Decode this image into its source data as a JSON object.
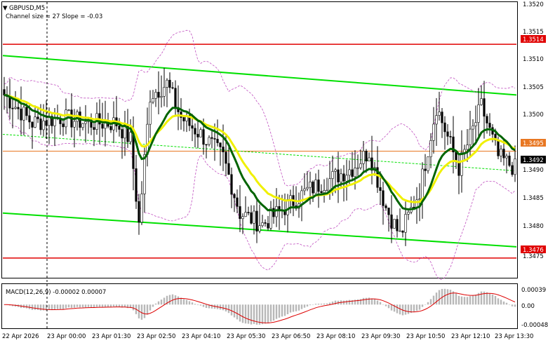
{
  "window": {
    "symbol_title": "GBPUSD,M5",
    "indicator_line": "Channel size = 27 Slope = -0.03",
    "menu_icon": "triangle-down-icon"
  },
  "price_axis": {
    "ticks": [
      "1.3520",
      "1.3515",
      "1.3510",
      "1.3505",
      "1.3500",
      "1.3490",
      "1.3485",
      "1.3480",
      "1.3475"
    ],
    "badges": [
      {
        "label": "1.3514",
        "color": "#e00000",
        "text_color": "#ffffff"
      },
      {
        "label": "1.3495",
        "color": "#e87722",
        "text_color": "#ffffff"
      },
      {
        "label": "1.3492",
        "color": "#000000",
        "text_color": "#ffffff"
      },
      {
        "label": "1.3476",
        "color": "#e00000",
        "text_color": "#ffffff"
      }
    ]
  },
  "macd": {
    "header": "MACD(12,26,9) -0.00002 0.00007",
    "ticks": [
      "0.00039",
      "0.00",
      "-0.00048"
    ]
  },
  "time_axis": {
    "labels": [
      "22 Apr 2026",
      "23 Apr 00:00",
      "23 Apr 01:30",
      "23 Apr 02:50",
      "23 Apr 04:10",
      "23 Apr 05:30",
      "23 Apr 06:50",
      "23 Apr 08:10",
      "23 Apr 09:30",
      "23 Apr 10:50",
      "23 Apr 12:10",
      "23 Apr 13:30"
    ]
  },
  "colors": {
    "resistance_line": "#e00000",
    "support_line": "#e00000",
    "channel": "#00e000",
    "ma_fast": "#006400",
    "ma_slow": "#f0f000",
    "bollinger": "#c050c0",
    "bid_line": "#e87722",
    "candle": "#000000",
    "macd_hist": "#b8b8b8",
    "macd_signal": "#dd0000"
  },
  "chart_data": {
    "type": "candlestick",
    "price_range": [
      1.34725,
      1.35215
    ],
    "resistance": 1.3514,
    "support": 1.3476,
    "current_bid": 1.3495,
    "last_price": 1.3492,
    "channel": {
      "upper": {
        "start": 1.3512,
        "end": 1.3505
      },
      "lower": {
        "start": 1.3484,
        "end": 1.3478
      }
    },
    "anchor_points": [
      [
        0,
        1.3505
      ],
      [
        10,
        1.35
      ],
      [
        20,
        1.3501
      ],
      [
        30,
        1.35
      ],
      [
        40,
        1.35
      ],
      [
        45,
        1.3497
      ],
      [
        48,
        1.3482
      ],
      [
        52,
        1.3505
      ],
      [
        58,
        1.3507
      ],
      [
        63,
        1.3501
      ],
      [
        70,
        1.3498
      ],
      [
        78,
        1.3494
      ],
      [
        84,
        1.3484
      ],
      [
        92,
        1.3482
      ],
      [
        100,
        1.3485
      ],
      [
        108,
        1.3488
      ],
      [
        116,
        1.349
      ],
      [
        124,
        1.3492
      ],
      [
        130,
        1.3495
      ],
      [
        136,
        1.3485
      ],
      [
        141,
        1.348
      ],
      [
        148,
        1.3488
      ],
      [
        154,
        1.3503
      ],
      [
        162,
        1.3492
      ],
      [
        170,
        1.3503
      ],
      [
        176,
        1.3494
      ],
      [
        182,
        1.3492
      ]
    ],
    "macd_range": [
      -0.00052,
      0.00045
    ]
  }
}
